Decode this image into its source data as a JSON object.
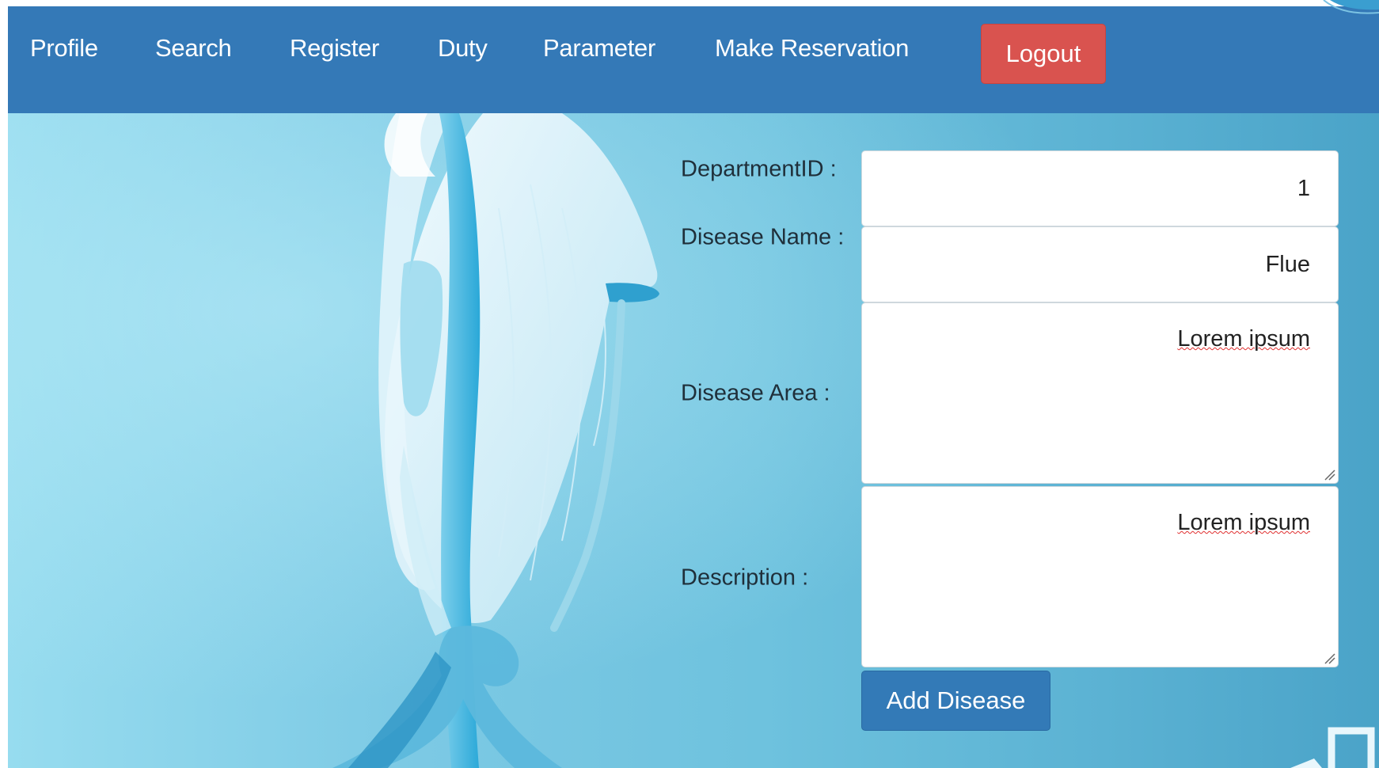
{
  "nav": {
    "items": [
      {
        "label": "Profile"
      },
      {
        "label": "Search"
      },
      {
        "label": "Register"
      },
      {
        "label": "Duty"
      },
      {
        "label": "Parameter"
      },
      {
        "label": "Make Reservation"
      }
    ],
    "logout_label": "Logout"
  },
  "form": {
    "department_id": {
      "label": "DepartmentID :",
      "value": "1"
    },
    "disease_name": {
      "label": "Disease Name :",
      "value": "Flue"
    },
    "disease_area": {
      "label": "Disease Area :",
      "value": "Lorem ipsum"
    },
    "description": {
      "label": "Description :",
      "value": "Lorem ipsum"
    },
    "submit_label": "Add Disease"
  },
  "colors": {
    "navbar": "#3479b7",
    "logout": "#d9534f",
    "primary_button": "#337ab7",
    "background_light": "#97dcef",
    "background_dark": "#4aa3c8"
  }
}
